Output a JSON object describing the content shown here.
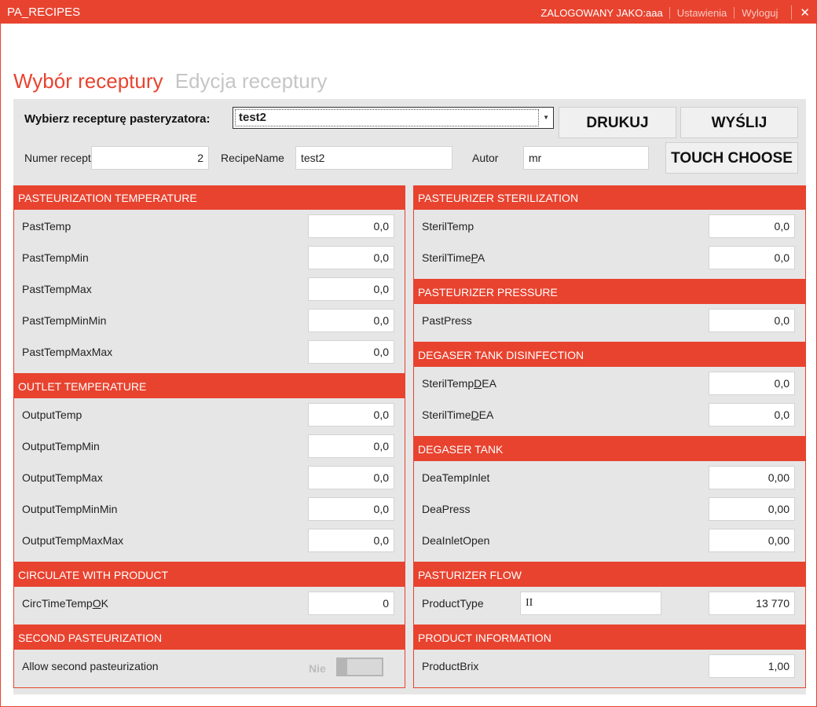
{
  "window": {
    "title": "PA_RECIPES",
    "user_label": "ZALOGOWANY JAKO:aaa",
    "settings_link": "Ustawienia",
    "logout_link": "Wyloguj",
    "close_glyph": "✕"
  },
  "tabs": [
    {
      "label": "Wybór receptury",
      "active": true
    },
    {
      "label": "Edycja receptury",
      "active": false
    }
  ],
  "header": {
    "choose_label": "Wybierz recepturę pasteryzatora:",
    "selected_recipe": "test2",
    "print_button": "DRUKUJ",
    "send_button": "WYŚLIJ",
    "touch_button": "TOUCH CHOOSE",
    "recipe_number_label": "Numer recept",
    "recipe_number_value": "2",
    "recipe_name_label": "RecipeName",
    "recipe_name_value": "test2",
    "author_label": "Autor",
    "author_value": "mr"
  },
  "left": {
    "past_temp": {
      "title": "PASTEURIZATION TEMPERATURE",
      "rows": [
        {
          "label": "PastTemp",
          "value": "0,0"
        },
        {
          "label": "PastTempMin",
          "value": "0,0"
        },
        {
          "label": "PastTempMax",
          "value": "0,0"
        },
        {
          "label": "PastTempMinMin",
          "value": "0,0"
        },
        {
          "label": "PastTempMaxMax",
          "value": "0,0"
        }
      ]
    },
    "outlet_temp": {
      "title": "OUTLET TEMPERATURE",
      "rows": [
        {
          "label": "OutputTemp",
          "value": "0,0"
        },
        {
          "label": "OutputTempMin",
          "value": "0,0"
        },
        {
          "label": "OutputTempMax",
          "value": "0,0"
        },
        {
          "label": "OutputTempMinMin",
          "value": "0,0"
        },
        {
          "label": "OutputTempMaxMax",
          "value": "0,0"
        }
      ]
    },
    "circulate": {
      "title": "CIRCULATE WITH PRODUCT",
      "label_pre": "CircTimeTemp",
      "label_acc": "O",
      "label_post": "K",
      "value": "0"
    },
    "second_past": {
      "title": "SECOND PASTEURIZATION",
      "label": "Allow second pasteurization",
      "toggle_text": "Nie",
      "toggle_on": false
    }
  },
  "right": {
    "sterilization": {
      "title": "PASTEURIZER STERILIZATION",
      "temp_label": "SterilTemp",
      "temp_value": "0,0",
      "time_label_pre": "SterilTime",
      "time_label_acc": "P",
      "time_label_post": "A",
      "time_value": "0,0"
    },
    "pressure": {
      "title": "PASTEURIZER PRESSURE",
      "label": "PastPress",
      "value": "0,0"
    },
    "degaser_disinfection": {
      "title": "DEGASER TANK DISINFECTION",
      "temp_label_pre": "SterilTemp",
      "temp_label_acc": "D",
      "temp_label_post": "EA",
      "temp_value": "0,0",
      "time_label_pre": "SterilTime",
      "time_label_acc": "D",
      "time_label_post": "EA",
      "time_value": "0,0"
    },
    "degaser_tank": {
      "title": "DEGASER TANK",
      "rows": [
        {
          "label": "DeaTempInlet",
          "value": "0,00"
        },
        {
          "label": "DeaPress",
          "value": "0,00"
        },
        {
          "label": "DeaInletOpen",
          "value": "0,00"
        }
      ]
    },
    "flow": {
      "title": "PASTURIZER FLOW",
      "label": "ProductType",
      "type_value": "II",
      "value": "13 770"
    },
    "product_info": {
      "title": "PRODUCT INFORMATION",
      "label": "ProductBrix",
      "value": "1,00"
    }
  },
  "colors": {
    "accent": "#e8432f",
    "panel": "#e6e6e6"
  }
}
